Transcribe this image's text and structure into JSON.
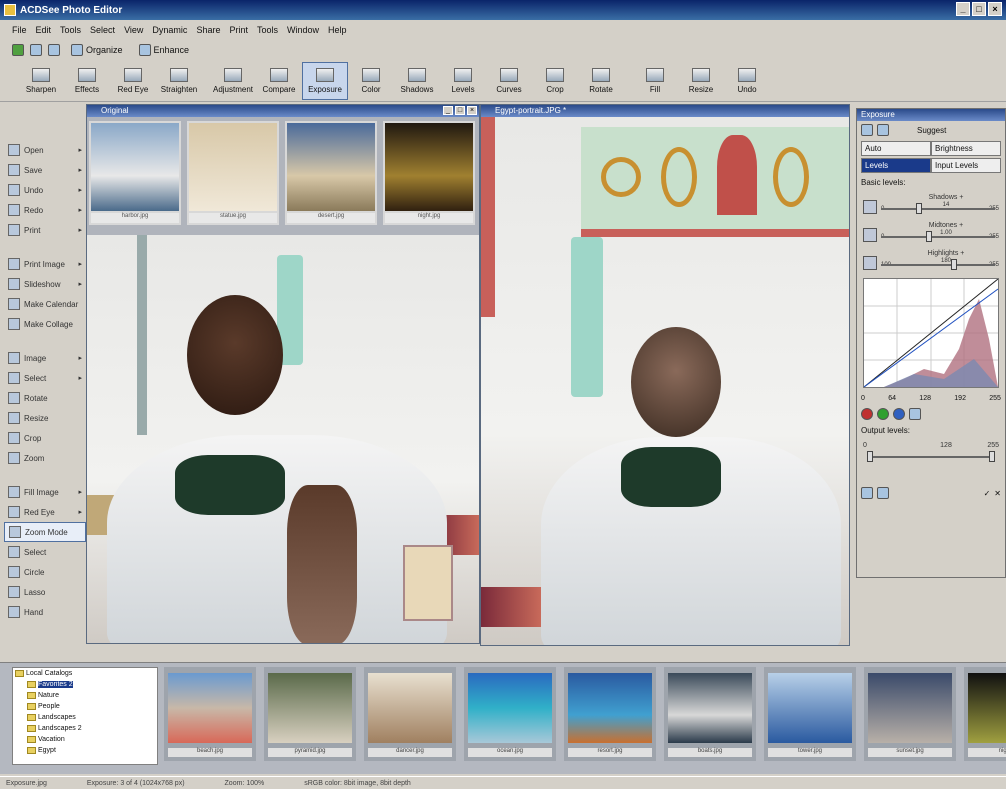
{
  "window": {
    "title": "ACDSee Photo Editor",
    "controls": [
      "_",
      "□",
      "×"
    ]
  },
  "menu": [
    "File",
    "Edit",
    "Tools",
    "Select",
    "View",
    "Dynamic",
    "Share",
    "Print",
    "Tools",
    "Window",
    "Help"
  ],
  "quickbar": {
    "items": [
      "Organize",
      "Enhance"
    ]
  },
  "toolbar": {
    "items": [
      "Sharpen",
      "Effects",
      "Red Eye",
      "Straighten",
      "Adjustment",
      "Compare",
      "Exposure",
      "Color",
      "Shadows",
      "Levels",
      "Curves",
      "Crop",
      "Rotate",
      "Fill",
      "Resize",
      "Undo"
    ],
    "active_index": 6
  },
  "leftpanel": {
    "group1": [
      "Open",
      "Save",
      "Undo",
      "Redo",
      "Print"
    ],
    "group2": [
      "Print Image",
      "Slideshow",
      "Make Calendar",
      "Make Collage"
    ],
    "group3": [
      "Image",
      "Select",
      "Rotate",
      "Resize",
      "Crop",
      "Zoom"
    ],
    "group4": [
      "Fill Image",
      "Red Eye",
      "Zoom Mode",
      "Select",
      "Circle",
      "Lasso",
      "Hand"
    ],
    "selected": "Zoom Mode"
  },
  "left_window": {
    "title": "Original",
    "film_captions": [
      "harbor.jpg",
      "statue.jpg",
      "desert.jpg",
      "night.jpg"
    ]
  },
  "right_window": {
    "title": "Egypt-portrait.JPG *"
  },
  "exposure": {
    "title": "Exposure",
    "tabs_top": [
      "Auto",
      "Suggest"
    ],
    "mode_a": "Auto",
    "mode_a_value": "Brightness",
    "mode_b": "Levels",
    "mode_b_value": "Input Levels",
    "section": "Basic levels:",
    "sliders": [
      {
        "label": "Shadows +",
        "min": "0",
        "value": "14",
        "max": "255",
        "pos": 0.35
      },
      {
        "label": "Midtones +",
        "min": "0",
        "value": "1.00",
        "max": "255",
        "pos": 0.45
      },
      {
        "label": "Highlights +",
        "min": "100",
        "value": "180",
        "max": "255",
        "pos": 0.7
      }
    ],
    "curve_axis": [
      "0",
      "64",
      "128",
      "192",
      "255"
    ],
    "output_label": "Output levels:",
    "output_min": "0",
    "output_mid": "128",
    "output_max": "255"
  },
  "tree": {
    "root": "Local Catalogs",
    "items": [
      "Favorites 2",
      "Nature",
      "People",
      "Landscapes",
      "Landscapes 2",
      "Vacation",
      "Egypt"
    ]
  },
  "bottom_thumbs": [
    "beach.jpg",
    "pyramid.jpg",
    "dancer.jpg",
    "ocean.jpg",
    "resort.jpg",
    "boats.jpg",
    "tower.jpg",
    "sunset.jpg",
    "night.jpg"
  ],
  "statusbar": {
    "file": "Exposure.jpg",
    "info": "Exposure: 3 of 4 (1024x768 px)",
    "zoom": "Zoom: 100%",
    "color": "sRGB color: 8bit image, 8bit depth"
  }
}
